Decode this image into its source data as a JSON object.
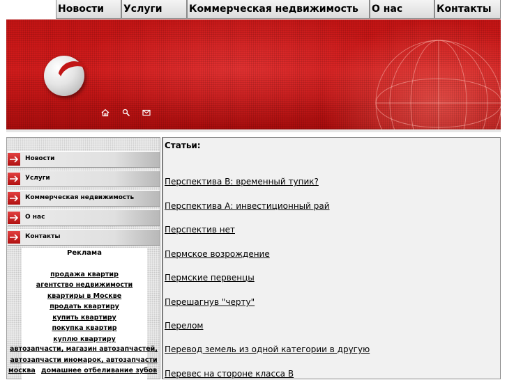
{
  "top_nav": {
    "items": [
      {
        "label": "Новости"
      },
      {
        "label": "Услуги"
      },
      {
        "label": "Коммерческая недвижимость"
      },
      {
        "label": "О нас"
      },
      {
        "label": "Контакты"
      }
    ]
  },
  "header": {
    "icons": [
      "home-icon",
      "search-icon",
      "mail-icon"
    ],
    "accent_color": "#c41414"
  },
  "sidebar": {
    "menu": [
      {
        "label": "Новости"
      },
      {
        "label": "Услуги"
      },
      {
        "label": "Коммерческая недвижимость"
      },
      {
        "label": "О нас"
      },
      {
        "label": "Контакты"
      }
    ],
    "ads": {
      "title": "Реклама",
      "links": [
        "продажа квартир",
        "агентство недвижимости",
        "квартиры в Москве",
        "продать квартиру",
        "купить квартиру",
        "покупка квартир",
        "куплю квартиру"
      ],
      "wide_links": [
        "автозапчасти, магазин автозапчастей,",
        "автозапчасти иномарок, автозапчасти",
        "москва",
        "домашнее отбеливание зубов"
      ]
    }
  },
  "content": {
    "title": "Статьи:",
    "articles": [
      "Перспектива B: временный тупик?",
      "Перспектива А: инвестиционный рай",
      "Перспектив нет",
      "Пермское возрождение",
      "Пермские первенцы",
      "Перешагнув \"черту\"",
      "Перелом",
      "Перевод земель из одной категории в другую",
      "Перевес на стороне класса B"
    ]
  }
}
